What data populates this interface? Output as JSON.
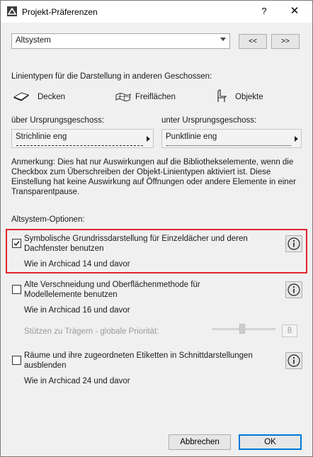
{
  "window": {
    "title": "Projekt-Präferenzen",
    "help_glyph": "?",
    "close_glyph": "✕"
  },
  "header": {
    "page_select_value": "Altsystem",
    "prev_label": "<<",
    "next_label": ">>"
  },
  "linetypes": {
    "heading": "Linientypen für die Darstellung in anderen Geschossen:",
    "items": [
      {
        "label": "Decken",
        "icon": "slab-icon"
      },
      {
        "label": "Freiflächen",
        "icon": "mesh-icon"
      },
      {
        "label": "Objekte",
        "icon": "chair-icon"
      }
    ],
    "above_label": "über Ursprungsgeschoss:",
    "above_value": "Strichlinie eng",
    "below_label": "unter Ursprungsgeschoss:",
    "below_value": "Punktlinie eng",
    "note": "Anmerkung: Dies hat nur Auswirkungen auf die Bibliothekselemente, wenn die Checkbox zum Überschreiben der Objekt-Linientypen aktiviert ist. Diese Einstellung hat keine Auswirkung auf Öffnungen oder andere Elemente in einer Transparentpause."
  },
  "legacy": {
    "heading": "Altsystem-Optionen:",
    "options": [
      {
        "label": "Symbolische Grundrissdarstellung für Einzeldächer und deren Dachfenster benutzen",
        "checked": true,
        "sub": "Wie in Archicad 14 und davor"
      },
      {
        "label": "Alte Verschneidung und Oberflächenmethode für Modellelemente benutzen",
        "checked": false,
        "sub": "Wie in Archicad 16 und davor"
      },
      {
        "label": "Räume und ihre zugeordneten Etiketten in Schnittdarstellungen ausblenden",
        "checked": false,
        "sub": "Wie in Archicad 24 und davor"
      }
    ],
    "priority_label": "Stützen zu Trägern - globale Priorität:",
    "priority_value": "8"
  },
  "footer": {
    "cancel_label": "Abbrechen",
    "ok_label": "OK"
  },
  "colors": {
    "highlight": "#e0262b",
    "default_button_border": "#0078d7"
  }
}
